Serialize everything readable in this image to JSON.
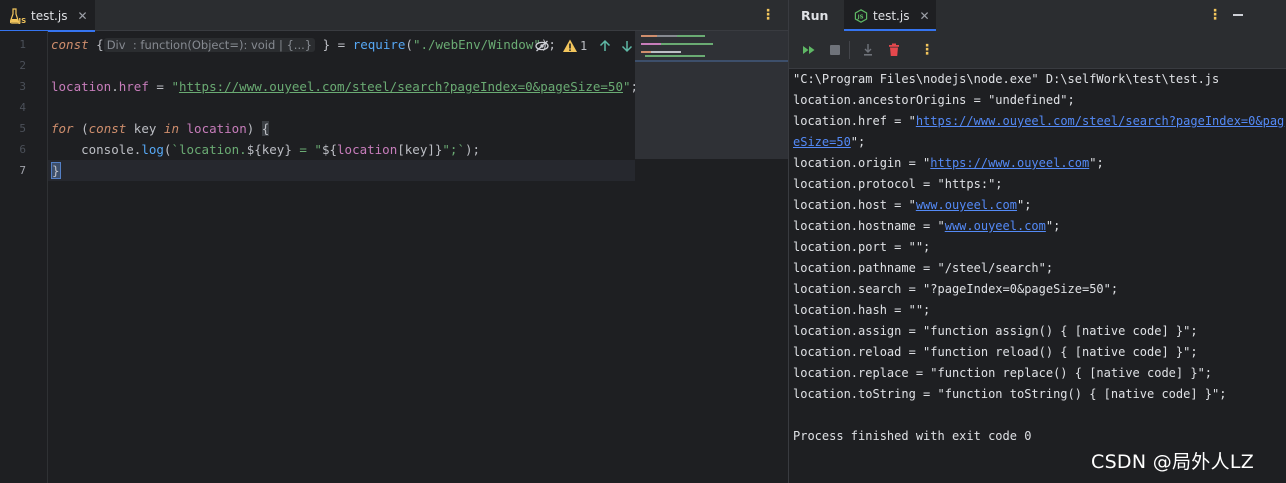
{
  "editor": {
    "tab": {
      "label": "test.js"
    },
    "line_numbers": [
      "1",
      "2",
      "3",
      "4",
      "5",
      "6",
      "7"
    ],
    "code": {
      "l1_kw": "const",
      "l1_open": " {",
      "l1_hint": "Div  : function(Object=): void | {...}",
      "l1_close": " } = ",
      "l1_fn": "require",
      "l1_paren_open": "(",
      "l1_str": "\"./webEnv/Window\"",
      "l1_paren_close": ");",
      "l3_obj": "location",
      "l3_dot": ".",
      "l3_prop": "href",
      "l3_eq": " = ",
      "l3_q1": "\"",
      "l3_url": "https://www.ouyeel.com/steel/search?pageIndex=0&pageSize=50",
      "l3_q2": "\"",
      "l3_end": ";",
      "l5_for": "for",
      "l5_open": " (",
      "l5_const": "const",
      "l5_key": " key ",
      "l5_in": "in",
      "l5_sp": " ",
      "l5_loc": "location",
      "l5_close": ") ",
      "l5_brace": "{",
      "l6_indent": "    ",
      "l6_console": "console",
      "l6_dot": ".",
      "l6_log": "log",
      "l6_p1": "(",
      "l6_t1": "`location.",
      "l6_i1": "${key}",
      "l6_t2": " = \"",
      "l6_i2a": "${",
      "l6_i2b": "location",
      "l6_i2c": "[key]}",
      "l6_t3": "\";`",
      "l6_p2": ");",
      "l7_brace": "}"
    },
    "inspections": {
      "warning_count": "1"
    }
  },
  "run": {
    "title": "Run",
    "tab": {
      "label": "test.js"
    },
    "console": [
      {
        "text": "\"C:\\Program Files\\nodejs\\node.exe\" D:\\selfWork\\test\\test.js"
      },
      {
        "text": "location.ancestorOrigins = \"undefined\";"
      },
      {
        "pre": "location.href = \"",
        "link": "https://www.ouyeel.com/steel/search?pageIndex=0&pag"
      },
      {
        "link": "eSize=50",
        "post": "\";"
      },
      {
        "pre": "location.origin = \"",
        "link": "https://www.ouyeel.com",
        "post": "\";"
      },
      {
        "text": "location.protocol = \"https:\";"
      },
      {
        "pre": "location.host = \"",
        "link": "www.ouyeel.com",
        "post": "\";"
      },
      {
        "pre": "location.hostname = \"",
        "link": "www.ouyeel.com",
        "post": "\";"
      },
      {
        "text": "location.port = \"\";"
      },
      {
        "text": "location.pathname = \"/steel/search\";"
      },
      {
        "text": "location.search = \"?pageIndex=0&pageSize=50\";"
      },
      {
        "text": "location.hash = \"\";"
      },
      {
        "text": "location.assign = \"function assign() { [native code] }\";"
      },
      {
        "text": "location.reload = \"function reload() { [native code] }\";"
      },
      {
        "text": "location.replace = \"function replace() { [native code] }\";"
      },
      {
        "text": "location.toString = \"function toString() { [native code] }\";"
      },
      {
        "text": ""
      },
      {
        "text": "Process finished with exit code 0"
      }
    ]
  },
  "watermark": "CSDN @局外人LZ",
  "colors": {
    "background": "#1e1f22",
    "panel": "#2b2d30",
    "accent": "#3574f0",
    "keyword": "#cf8e6d",
    "string": "#6aab73",
    "function": "#56a8f5",
    "property": "#c77dbb",
    "link": "#548af7",
    "warning": "#f2c55c",
    "run_green": "#5fb865",
    "stop_red": "#e5484d"
  }
}
